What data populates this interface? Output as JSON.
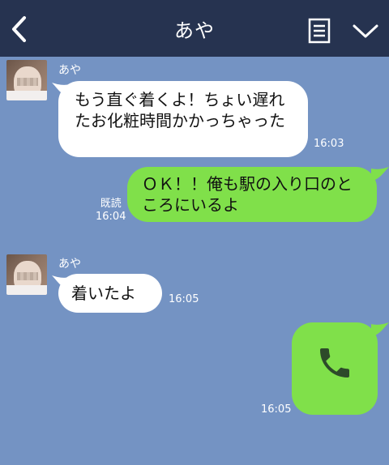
{
  "header": {
    "title": "あや"
  },
  "messages": [
    {
      "sender": "あや",
      "direction": "incoming",
      "text": "もう直ぐ着くよ！ちょい遅れたお化粧時間かかっちゃった",
      "time": "16:03"
    },
    {
      "direction": "outgoing",
      "text": "ＯＫ！！俺も駅の入り口のところにいるよ",
      "read": "既読",
      "time": "16:04"
    },
    {
      "sender": "あや",
      "direction": "incoming",
      "text": "着いたよ",
      "time": "16:05"
    },
    {
      "direction": "outgoing",
      "type": "call",
      "icon": "phone-icon",
      "time": "16:05"
    }
  ],
  "colors": {
    "header_bg": "#263350",
    "chat_bg": "#7493c3",
    "incoming_bubble": "#ffffff",
    "outgoing_bubble": "#80e04a"
  }
}
